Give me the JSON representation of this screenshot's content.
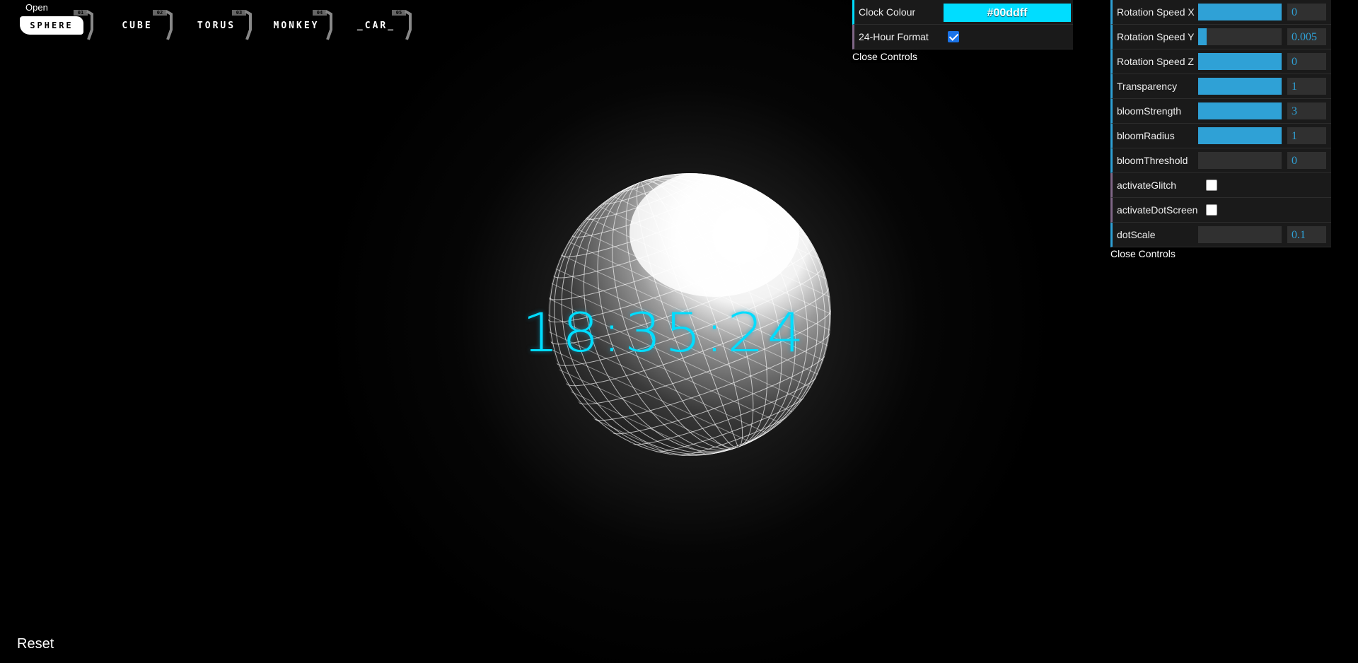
{
  "menu": {
    "open_label": "Open",
    "tabs": [
      {
        "label": "SPHERE",
        "tag": "01"
      },
      {
        "label": "CUBE",
        "tag": "02"
      },
      {
        "label": "TORUS",
        "tag": "03"
      },
      {
        "label": "MONKEY",
        "tag": "04"
      },
      {
        "label": "_CAR_",
        "tag": "05"
      }
    ]
  },
  "clock": {
    "time": "18:35:24",
    "color": "#00ddff"
  },
  "clock_controls": {
    "colour_label": "Clock Colour",
    "colour_value": "#00ddff",
    "format_label": "24-Hour Format",
    "format_checked": true,
    "close_label": "Close Controls"
  },
  "scene_controls": {
    "rotation_x": {
      "label": "Rotation Speed X",
      "value": "0",
      "fill": 1.0
    },
    "rotation_y": {
      "label": "Rotation Speed Y",
      "value": "0.005",
      "fill": 0.1
    },
    "rotation_z": {
      "label": "Rotation Speed Z",
      "value": "0",
      "fill": 1.0
    },
    "transparency": {
      "label": "Transparency",
      "value": "1",
      "fill": 1.0
    },
    "bloom_strength": {
      "label": "bloomStrength",
      "value": "3",
      "fill": 1.0
    },
    "bloom_radius": {
      "label": "bloomRadius",
      "value": "1",
      "fill": 1.0
    },
    "bloom_threshold": {
      "label": "bloomThreshold",
      "value": "0",
      "fill": 0.0
    },
    "activate_glitch": {
      "label": "activateGlitch",
      "checked": false
    },
    "activate_dot_screen": {
      "label": "activateDotScreen",
      "checked": false
    },
    "dot_scale": {
      "label": "dotScale",
      "value": "0.1",
      "fill": 0.0
    },
    "close_label": "Close Controls"
  },
  "reset_label": "Reset",
  "colors": {
    "accent_slider": "#2fa1d6",
    "clock": "#00ddff",
    "panel_bg": "#1a1a1a"
  }
}
